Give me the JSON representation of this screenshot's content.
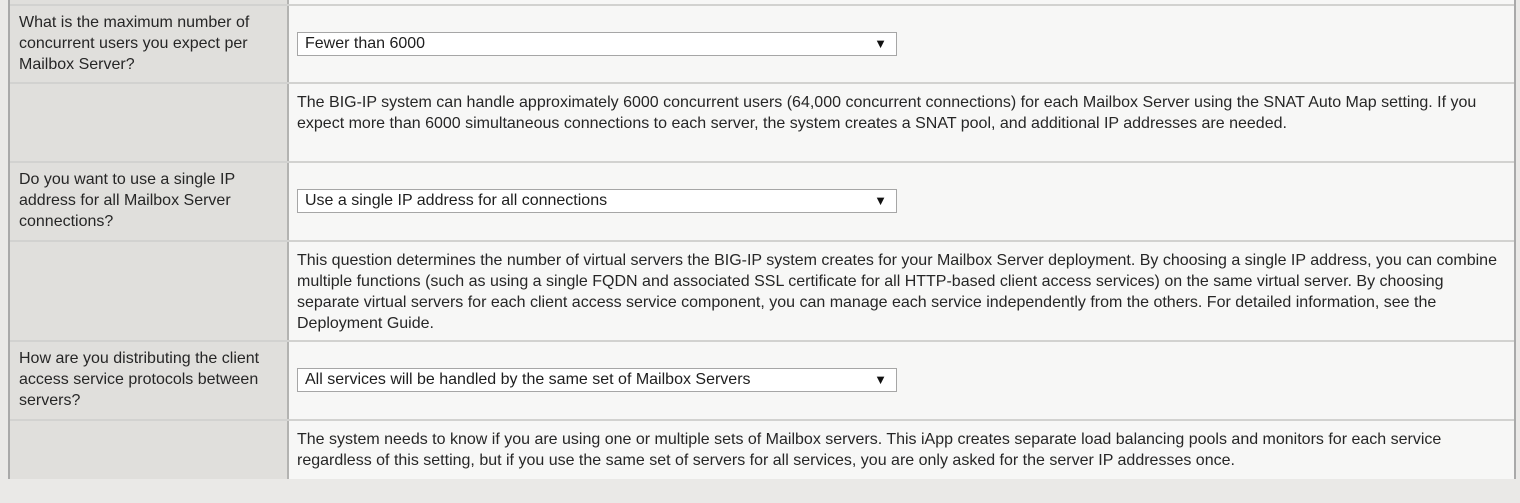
{
  "rows": [
    {
      "question": "What is the maximum number of concurrent users you expect per Mailbox Server?",
      "selected": "Fewer than 6000"
    },
    {
      "description": "The BIG-IP system can handle approximately 6000 concurrent users (64,000 concurrent connections) for each Mailbox Server using the SNAT Auto Map setting. If you expect more than 6000 simultaneous connections to each server, the system creates a SNAT pool, and additional IP addresses are needed."
    },
    {
      "question": "Do you want to use a single IP address for all Mailbox Server connections?",
      "selected": "Use a single IP address for all connections"
    },
    {
      "description": "This question determines the number of virtual servers the BIG-IP system creates for your Mailbox Server deployment. By choosing a single IP address, you can combine multiple functions (such as using a single FQDN and associated SSL certificate for all HTTP-based client access services) on the same virtual server. By choosing separate virtual servers for each client access service component, you can manage each service independently from the others. For detailed information, see the Deployment Guide."
    },
    {
      "question": "How are you distributing the client access service protocols between servers?",
      "selected": "All services will be handled by the same set of Mailbox Servers"
    },
    {
      "description": "The system needs to know if you are using one or multiple sets of Mailbox servers. This iApp creates separate load balancing pools and monitors for each service regardless of this setting, but if you use the same set of servers for all services, you are only asked for the server IP addresses once."
    }
  ],
  "icons": {
    "dropdown_arrow": "▼"
  }
}
